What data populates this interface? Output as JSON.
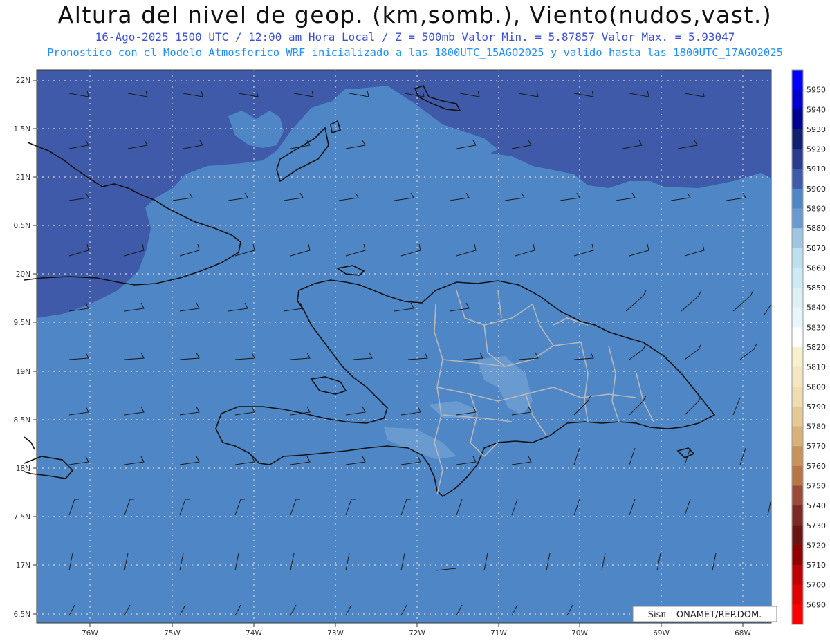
{
  "header": {
    "title": "Altura del nivel de geop. (km,somb.), Viento(nudos,vast.)",
    "subtitle": "16-Ago-2025  1500 UTC / 12:00 am Hora Local / Z = 500mb   Valor Min. = 5.87857  Valor Max. = 5.93047",
    "subtitle2": "Pronostico con el Modelo Atmosferico WRF inicializado a las 1800UTC_15AGO2025 y valido hasta las  1800UTC_17AGO2025"
  },
  "map": {
    "lat_labels": [
      "22N",
      "1.5N",
      "21N",
      "0.5N",
      "20N",
      "9.5N",
      "19N",
      "8.5N",
      "18N",
      "7.5N",
      "17N",
      "6.5N"
    ],
    "lon_labels": [
      "76W",
      "75W",
      "74W",
      "73W",
      "72W",
      "71W",
      "70W",
      "69W",
      "68W"
    ],
    "credit": "Sisπ – ONAMET/REP.DOM.",
    "colors": {
      "field": "#4f86c6",
      "high": "#3f5aa8",
      "low": "#5e96cf",
      "coast": "#111111",
      "border": "#b8b8b8",
      "grid": "#d8d8d8"
    }
  },
  "colorbar": {
    "levels": [
      "5950",
      "5940",
      "5930",
      "5920",
      "5910",
      "5900",
      "5890",
      "5880",
      "5870",
      "5860",
      "5850",
      "5840",
      "5830",
      "5820",
      "5810",
      "5800",
      "5790",
      "5780",
      "5770",
      "5760",
      "5750",
      "5740",
      "5730",
      "5720",
      "5710",
      "5700",
      "5690"
    ],
    "colors": [
      "#0000ff",
      "#0000d0",
      "#000090",
      "#102070",
      "#2a3a8e",
      "#3f5aa8",
      "#4f86c6",
      "#6a9bd0",
      "#9ec6e2",
      "#bde0ee",
      "#cdeaf2",
      "#dcf0f6",
      "#e6f6fa",
      "#ffffff",
      "#f8f0cc",
      "#f4e6c0",
      "#efdcb0",
      "#e6c894",
      "#d8b078",
      "#c8925a",
      "#b87648",
      "#9a4a36",
      "#7a2a26",
      "#6a1414",
      "#900000",
      "#c00000",
      "#e00000",
      "#ff0000"
    ]
  }
}
